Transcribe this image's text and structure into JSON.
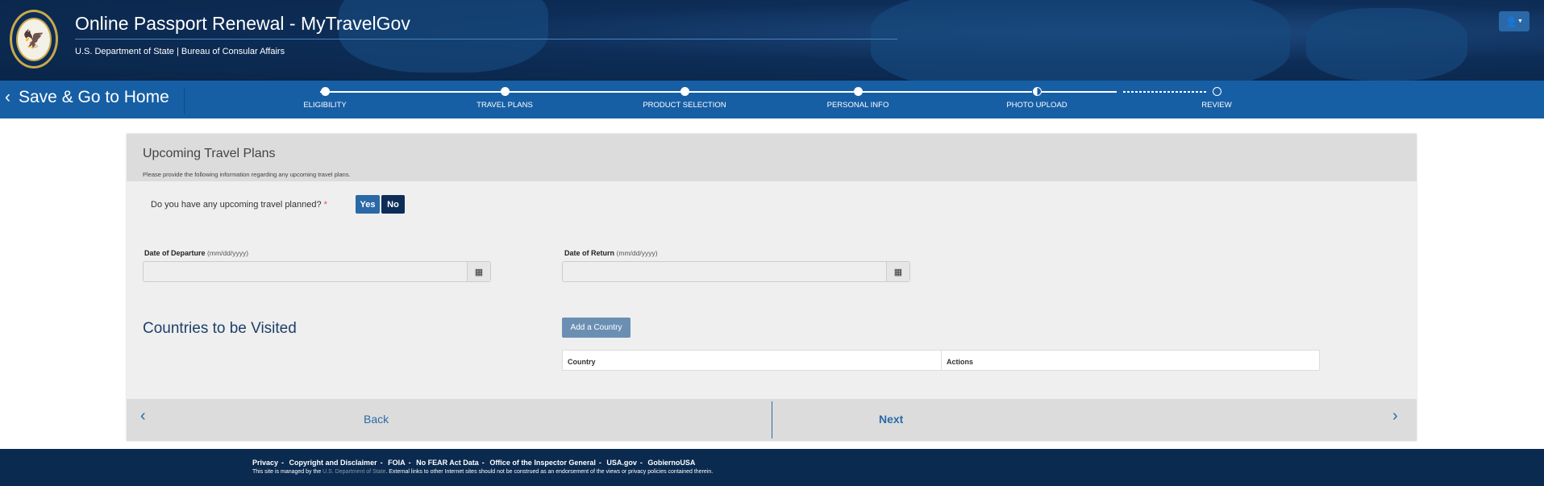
{
  "header": {
    "title": "Online Passport Renewal - MyTravelGov",
    "subtitle": "U.S. Department of State | Bureau of Consular Affairs",
    "seal_text": "Department of State - United States of America",
    "user_icon": "user-icon"
  },
  "nav": {
    "back_label": "Save & Go to Home",
    "steps": [
      {
        "label": "ELIGIBILITY",
        "state": "complete"
      },
      {
        "label": "TRAVEL PLANS",
        "state": "complete"
      },
      {
        "label": "PRODUCT SELECTION",
        "state": "complete"
      },
      {
        "label": "PERSONAL INFO",
        "state": "complete"
      },
      {
        "label": "PHOTO UPLOAD",
        "state": "in-progress"
      },
      {
        "label": "REVIEW",
        "state": "incomplete"
      }
    ]
  },
  "form": {
    "title": "Upcoming Travel Plans",
    "description": "Please provide the following information regarding any upcoming travel plans.",
    "question": "Do you have any upcoming travel planned?",
    "required": "*",
    "yes": "Yes",
    "no": "No",
    "departure_label": "Date of Departure",
    "departure_format": "(mm/dd/yyyy)",
    "departure_value": "",
    "return_label": "Date of Return",
    "return_format": "(mm/dd/yyyy)",
    "return_value": "",
    "countries_title": "Countries to be Visited",
    "add_country": "Add a Country",
    "table_headers": [
      "Country",
      "Actions"
    ],
    "back": "Back",
    "next": "Next"
  },
  "footer": {
    "links": [
      "Privacy",
      "Copyright and Disclaimer",
      "FOIA",
      "No FEAR Act Data",
      "Office of the Inspector General",
      "USA.gov",
      "GobiernoUSA"
    ],
    "note_pre": "This site is managed by the ",
    "note_link": "U.S. Department of State",
    "note_post": ". External links to other Internet sites should not be construed as an endorsement of the views or privacy policies contained therein."
  },
  "colors": {
    "header": "#0a2548",
    "navbar": "#175fa5",
    "footer": "#0b2a4f",
    "accent": "#2a6aa8"
  }
}
